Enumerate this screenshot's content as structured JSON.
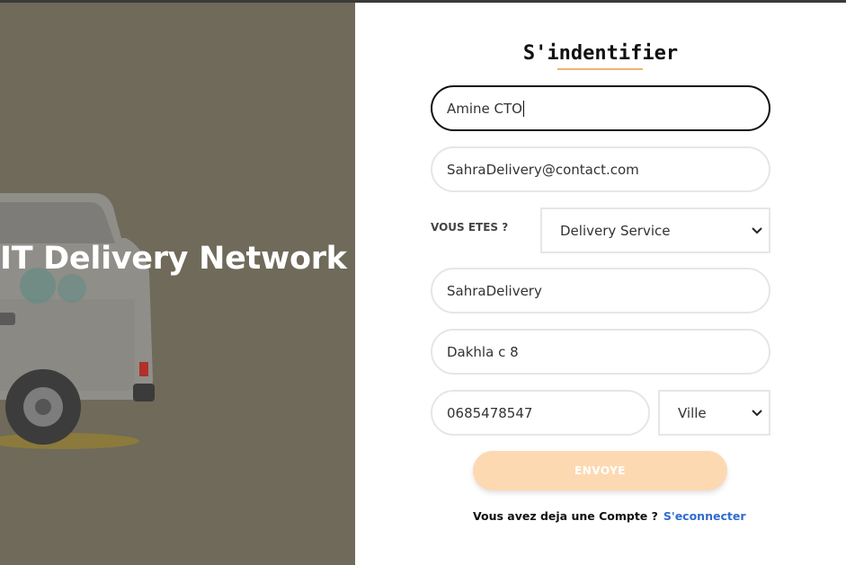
{
  "hero": {
    "title": "IT Delivery Network"
  },
  "form": {
    "title": "S'indentifier",
    "name_value": "Amine CTO",
    "email_value": "SahraDelivery@contact.com",
    "role_label": "VOUS ETES ?",
    "role_selected": "Delivery Service",
    "company_value": "SahraDelivery",
    "address_value": "Dakhla c 8",
    "phone_value": "0685478547",
    "city_selected": "Ville",
    "submit_label": "ENVOYE",
    "footer_text": "Vous avez deja une Compte ?",
    "footer_link": "S'econnecter"
  },
  "colors": {
    "hero_bg": "#6f6a5a",
    "accent_underline": "#f2b36a",
    "submit_bg": "#fdd9b2",
    "link": "#2f6bd1"
  },
  "icons": {
    "select_arrow": "chevron-down-icon"
  }
}
